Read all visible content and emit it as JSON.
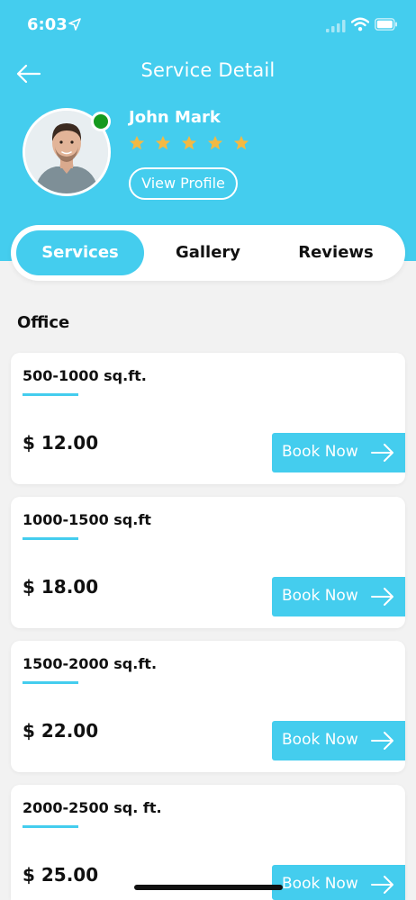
{
  "status_bar": {
    "time": "6:03",
    "icons": [
      "location-arrow-icon",
      "cellular-signal-icon",
      "wifi-icon",
      "battery-icon"
    ]
  },
  "header": {
    "title": "Service Detail",
    "back_icon": "back-arrow-icon",
    "background_color": "#44cdee"
  },
  "profile": {
    "name": "John Mark",
    "rating": 5,
    "rating_max": 5,
    "star_color": "#f4b942",
    "online_color": "#149a1e",
    "view_profile_label": "View Profile"
  },
  "tabs": [
    {
      "label": "Services",
      "active": true
    },
    {
      "label": "Gallery",
      "active": false
    },
    {
      "label": "Reviews",
      "active": false
    }
  ],
  "section": {
    "title": "Office"
  },
  "services": [
    {
      "size": "500-1000 sq.ft.",
      "price": "$ 12.00",
      "button_label": "Book Now"
    },
    {
      "size": "1000-1500 sq.ft",
      "price": "$ 18.00",
      "button_label": "Book Now"
    },
    {
      "size": "1500-2000 sq.ft.",
      "price": "$ 22.00",
      "button_label": "Book Now"
    },
    {
      "size": "2000-2500 sq. ft.",
      "price": "$ 25.00",
      "button_label": "Book Now"
    }
  ],
  "accent_color": "#44cdee"
}
